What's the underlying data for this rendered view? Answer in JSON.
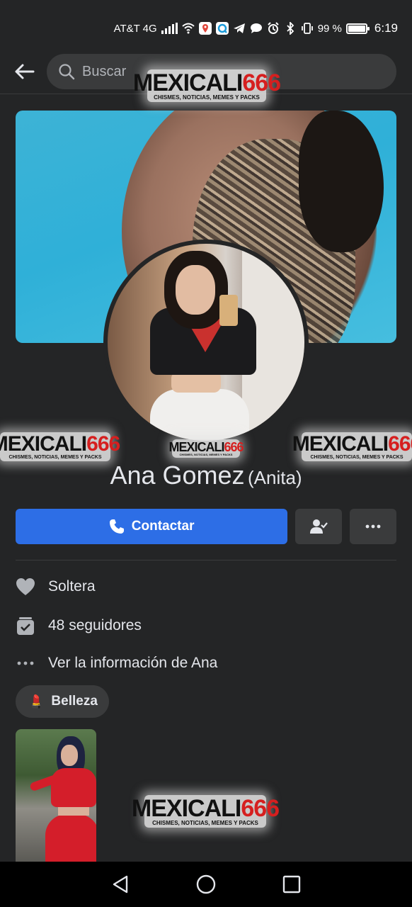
{
  "status_bar": {
    "carrier": "AT&T 4G",
    "battery_percent": "99 %",
    "battery_level": 0.99,
    "time": "6:19",
    "icons": [
      "signal-icon",
      "wifi-icon",
      "location-app-icon",
      "messenger-app-icon",
      "telegram-icon",
      "chat-icon",
      "alarm-icon",
      "bluetooth-icon",
      "vibrate-icon",
      "battery-icon"
    ]
  },
  "header": {
    "search_placeholder": "Buscar"
  },
  "watermarks": {
    "main_prefix": "MEXICALI",
    "main_number": "666",
    "subtitle": "CHISMES, NOTICIAS, MEMES Y PACKS"
  },
  "profile": {
    "name": "Ana Gomez",
    "alternate_name": "(Anita)"
  },
  "actions": {
    "contact_label": "Contactar"
  },
  "info": {
    "relationship": "Soltera",
    "followers": "48 seguidores",
    "see_info": "Ver la información de Ana"
  },
  "interest_chip": {
    "emoji": "💄",
    "label": "Belleza"
  },
  "colors": {
    "background": "#242526",
    "surface": "#3a3b3c",
    "accent": "#2d6ee6",
    "text": "#e4e6eb",
    "muted": "#b0b3b8",
    "watermark_red": "#d61f1f"
  }
}
